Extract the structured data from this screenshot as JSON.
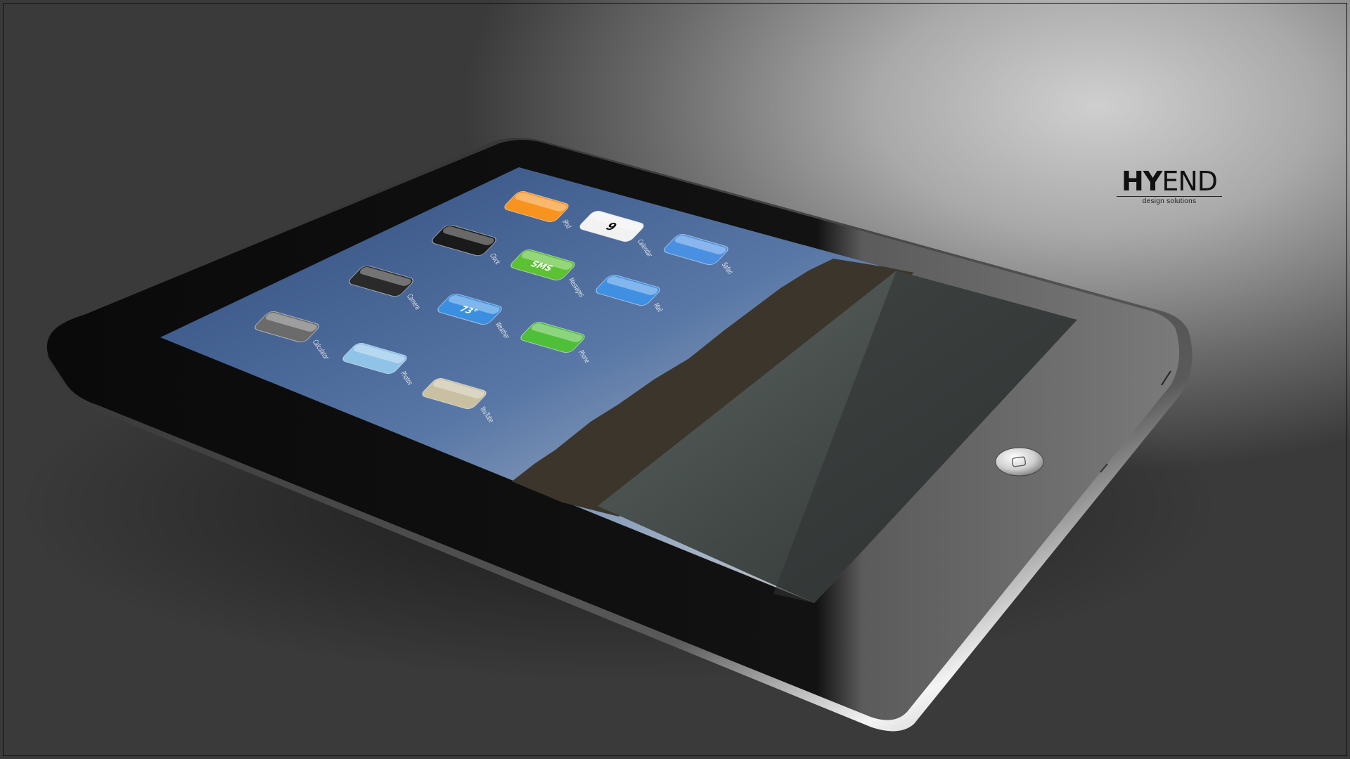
{
  "watermark": {
    "brand_bold": "HY",
    "brand_light": "END",
    "tagline": "design solutions"
  },
  "apps": [
    {
      "label": "iPod",
      "icon": "ipod-icon",
      "color": "#f7931e"
    },
    {
      "label": "Calendar",
      "icon": "calendar-icon",
      "color": "#f2f2f2",
      "day": "9"
    },
    {
      "label": "Safari",
      "icon": "safari-icon",
      "color": "#4a90e2"
    },
    {
      "label": "Clock",
      "icon": "clock-icon",
      "color": "#1a1a1a"
    },
    {
      "label": "Messages",
      "icon": "sms-icon",
      "color": "#5cc133",
      "text": "SMS"
    },
    {
      "label": "Mail",
      "icon": "mail-icon",
      "color": "#3f8fe3"
    },
    {
      "label": "Camera",
      "icon": "camera-icon",
      "color": "#2a2a2a"
    },
    {
      "label": "Weather",
      "icon": "weather-icon",
      "color": "#3b8fe0",
      "text": "73°"
    },
    {
      "label": "Phone",
      "icon": "phone-icon",
      "color": "#4fbf3a"
    },
    {
      "label": "Calculator",
      "icon": "calculator-icon",
      "color": "#6b6b6b"
    },
    {
      "label": "Photos",
      "icon": "photos-icon",
      "color": "#8fc3e8"
    },
    {
      "label": "YouTube",
      "icon": "youtube-icon",
      "color": "#c8c0a0"
    }
  ],
  "colors": {
    "bezel": "#0d0d0d",
    "chrome_edge": "#e6e6e6",
    "sky_top": "#3c5a8c",
    "sky_bottom": "#c9b8a0",
    "water": "#4e5552"
  }
}
